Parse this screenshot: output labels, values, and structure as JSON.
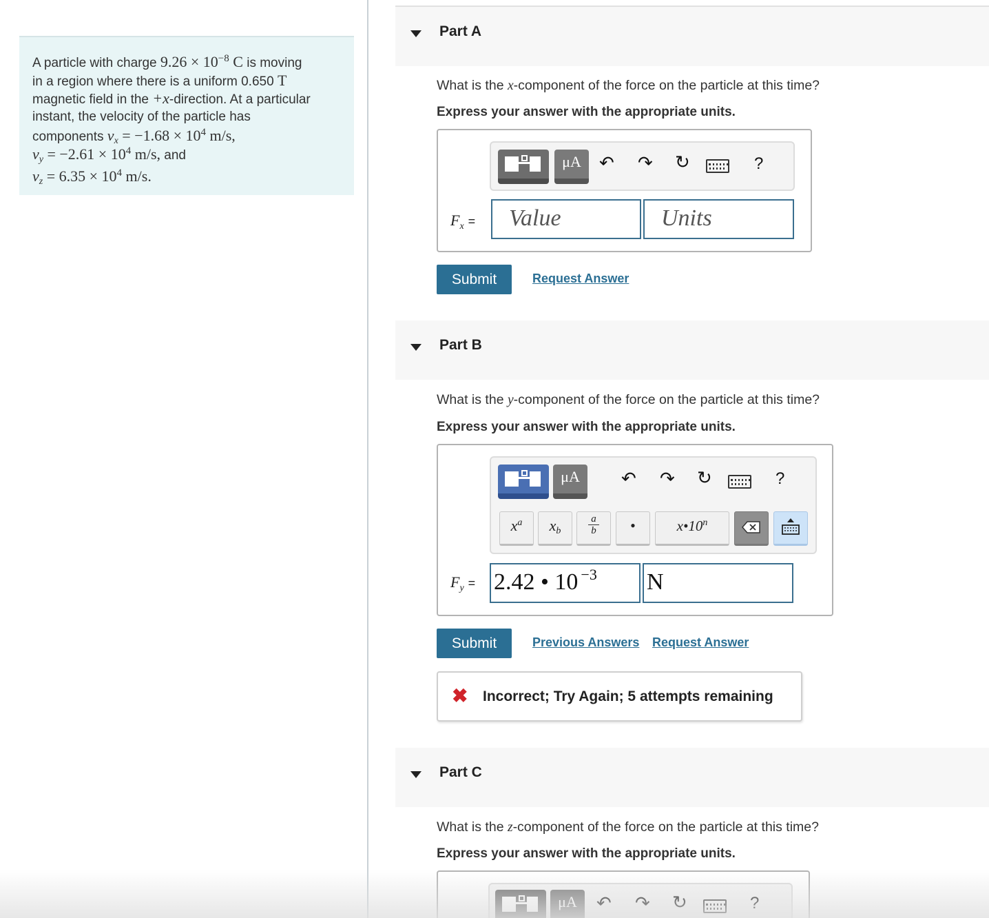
{
  "problem": {
    "line1_pre": "A particle with charge ",
    "charge_math": "9.26 × 10",
    "charge_exp": "−8",
    "charge_unit": " C",
    "line1_post": " is moving",
    "line2_pre": "in a region where there is a uniform 0.650 ",
    "field_unit": "T",
    "line3_pre": "magnetic field in the ",
    "direction": "+x",
    "line3_post": "-direction. At a particular",
    "line4": "instant, the velocity of the particle has",
    "line5_pre": "components ",
    "vx_sym": "v",
    "vx_sub": "x",
    "vx_val": " = −1.68 × 10",
    "vx_exp": "4",
    "vx_unit": " m/s,",
    "vy_sym": "v",
    "vy_sub": "y",
    "vy_val": " = −2.61 × 10",
    "vy_exp": "4",
    "vy_unit": " m/s,",
    "vy_post": " and",
    "vz_sym": "v",
    "vz_sub": "z",
    "vz_val": " = 6.35 × 10",
    "vz_exp": "4",
    "vz_unit": " m/s."
  },
  "partA": {
    "title": "Part A",
    "question_pre": "What is the ",
    "question_var": "x",
    "question_post": "-component of the force on the particle at this time?",
    "instruction": "Express your answer with the appropriate units.",
    "eq_sym": "F",
    "eq_sub": "x",
    "eq_sign": "=",
    "value_placeholder": "Value",
    "units_placeholder": "Units",
    "submit": "Submit",
    "request": "Request Answer"
  },
  "partB": {
    "title": "Part B",
    "question_pre": "What is the ",
    "question_var": "y",
    "question_post": "-component of the force on the particle at this time?",
    "instruction": "Express your answer with the appropriate units.",
    "eq_sym": "F",
    "eq_sub": "y",
    "eq_sign": "=",
    "value_mantissa": "2.42 • 10",
    "value_exp": "−3",
    "units_value": "N",
    "submit": "Submit",
    "previous": "Previous Answers",
    "request": "Request Answer",
    "feedback": "Incorrect; Try Again; 5 attempts remaining",
    "keypad": {
      "superscript_base": "x",
      "superscript_exp": "a",
      "subscript_base": "x",
      "subscript_sub": "b",
      "frac_num": "a",
      "frac_den": "b",
      "dot": "•",
      "sci": "x•10",
      "sci_exp": "n"
    }
  },
  "partC": {
    "title": "Part C",
    "question_pre": "What is the ",
    "question_var": "z",
    "question_post": "-component of the force on the particle at this time?",
    "instruction": "Express your answer with the appropriate units."
  },
  "toolbar": {
    "mu_label": "μA",
    "help": "?"
  },
  "colors": {
    "accent": "#2b6f94",
    "problem_bg": "#e8f5f6",
    "error": "#d0232a",
    "template_active": "#4a6fb3"
  },
  "icons": [
    "templates-icon",
    "units-mu-a-icon",
    "undo-icon",
    "redo-icon",
    "reset-icon",
    "keyboard-icon",
    "help-icon",
    "delete-icon",
    "keypad-toggle-icon",
    "incorrect-x-icon",
    "collapse-triangle-icon"
  ]
}
